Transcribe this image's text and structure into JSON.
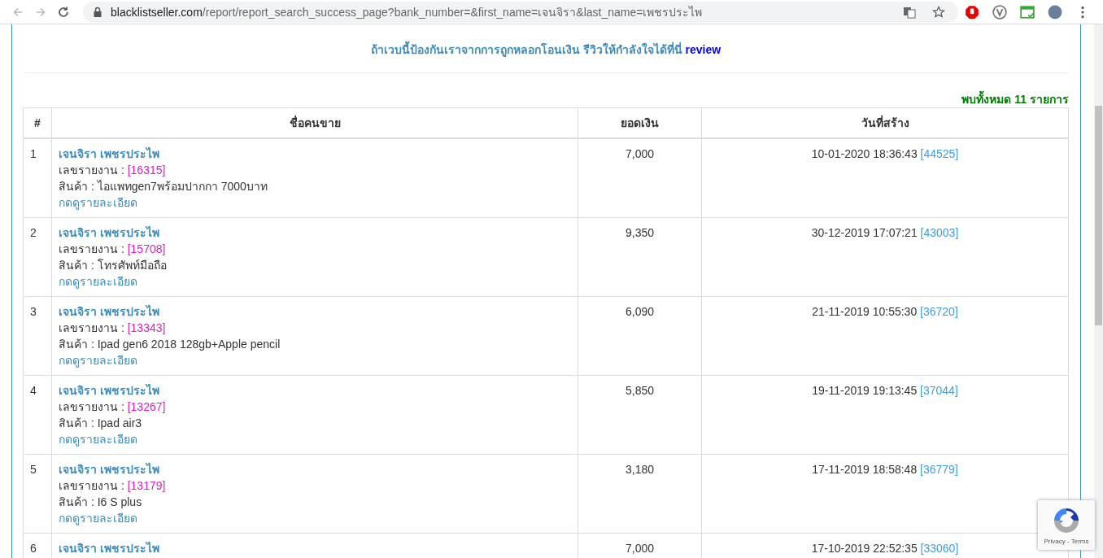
{
  "browser": {
    "url_host": "blacklistseller.com",
    "url_path": "/report/report_search_success_page?bank_number=&first_name=เจนจิรา&last_name=เพชรประไพ"
  },
  "banner": {
    "text": "ถ้าเวบนี้ป้องกันเราจากการถูกหลอกโอนเงิน รีวิวให้กำลังใจได้ที่นี่",
    "link": "review"
  },
  "result_count": "พบทั้งหมด 11 รายการ",
  "table": {
    "columns": [
      "#",
      "ชื่อคนขาย",
      "ยอดเงิน",
      "วันที่สร้าง"
    ],
    "rows": [
      {
        "index": "1",
        "seller": "เจนจิรา เพชรประไพ",
        "report_label": "เลขรายงาน :",
        "report_no": "[16315]",
        "product": "สินค้า : ไอแพทgen7พร้อมปากกา 7000บาท",
        "details_link": "กดดูรายละเอียด",
        "amount": "7,000",
        "created": "10-01-2020 18:36:43",
        "created_id": "[44525]"
      },
      {
        "index": "2",
        "seller": "เจนจิรา เพชรประไพ",
        "report_label": "เลขรายงาน :",
        "report_no": "[15708]",
        "product": "สินค้า : โทรศัพท์มือถือ",
        "details_link": "กดดูรายละเอียด",
        "amount": "9,350",
        "created": "30-12-2019 17:07:21",
        "created_id": "[43003]"
      },
      {
        "index": "3",
        "seller": "เจนจิรา เพชรประไพ",
        "report_label": "เลขรายงาน :",
        "report_no": "[13343]",
        "product": "สินค้า : Ipad gen6 2018 128gb+Apple pencil",
        "details_link": "กดดูรายละเอียด",
        "amount": "6,090",
        "created": "21-11-2019 10:55:30",
        "created_id": "[36720]"
      },
      {
        "index": "4",
        "seller": "เจนจิรา เพชรประไพ",
        "report_label": "เลขรายงาน :",
        "report_no": "[13267]",
        "product": "สินค้า : Ipad air3",
        "details_link": "กดดูรายละเอียด",
        "amount": "5,850",
        "created": "19-11-2019 19:13:45",
        "created_id": "[37044]"
      },
      {
        "index": "5",
        "seller": "เจนจิรา เพชรประไพ",
        "report_label": "เลขรายงาน :",
        "report_no": "[13179]",
        "product": "สินค้า : I6 S plus",
        "details_link": "กดดูรายละเอียด",
        "amount": "3,180",
        "created": "17-11-2019 18:58:48",
        "created_id": "[36779]"
      },
      {
        "index": "6",
        "seller": "เจนจิรา เพชรประไพ",
        "amount": "7,000",
        "created": "17-10-2019 22:52:35",
        "created_id": "[33060]"
      }
    ]
  },
  "recaptcha": {
    "text": "Privacy - Terms"
  }
}
